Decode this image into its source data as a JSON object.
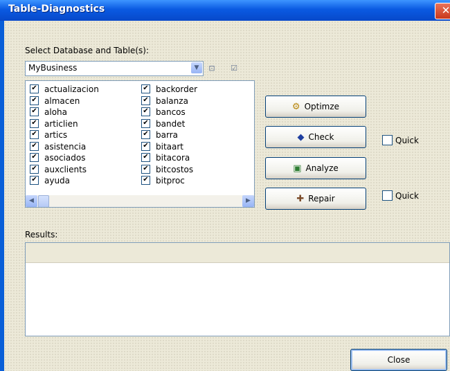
{
  "window": {
    "title": "Table-Diagnostics",
    "close_glyph": "✕"
  },
  "select_label": "Select Database and Table(s):",
  "database_combo": {
    "value": "MyBusiness"
  },
  "tables": {
    "left": [
      "actualizacion",
      "almacen",
      "aloha",
      "articlien",
      "artics",
      "asistencia",
      "asociados",
      "auxclients",
      "ayuda"
    ],
    "right": [
      "backorder",
      "balanza",
      "bancos",
      "bandet",
      "barra",
      "bitaart",
      "bitacora",
      "bitcostos",
      "bitproc"
    ]
  },
  "buttons": {
    "optimize": "Optimze",
    "check": "Check",
    "analyze": "Analyze",
    "repair": "Repair",
    "close": "Close"
  },
  "quick_label": "Quick",
  "results_label": "Results:",
  "icons": {
    "deselect_all": "deselect-all-icon",
    "select_all": "select-all-icon",
    "optimize": "optimize-icon",
    "check": "check-icon",
    "analyze": "analyze-icon",
    "repair": "repair-icon"
  }
}
